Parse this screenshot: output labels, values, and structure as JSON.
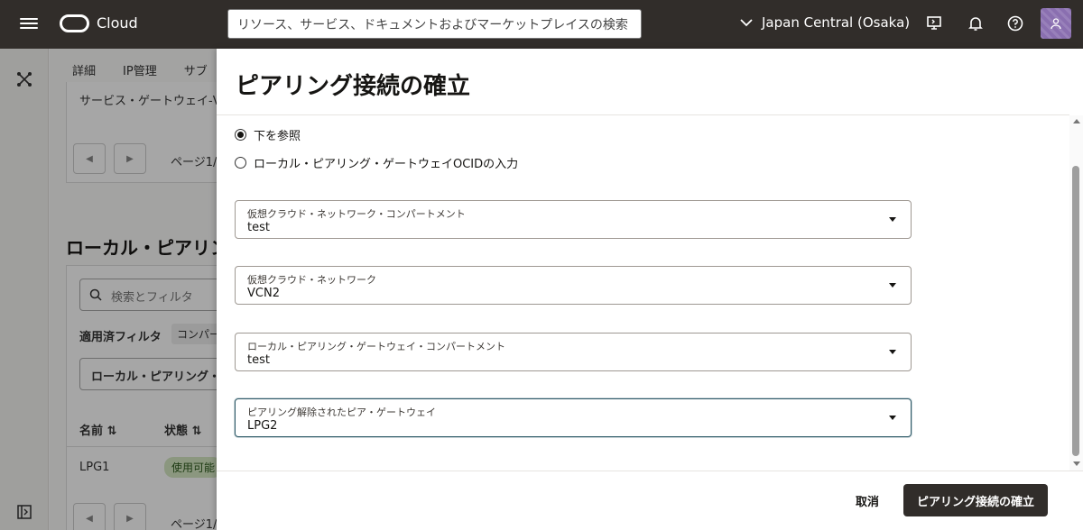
{
  "topbar": {
    "brand": "Cloud",
    "search_placeholder": "リソース、サービス、ドキュメントおよびマーケットプレイスの検索",
    "region": "Japan Central (Osaka)"
  },
  "background": {
    "tabs": [
      "詳細",
      "IP管理",
      "サブ"
    ],
    "service_gateway_text": "サービス・ゲートウェイ-V",
    "page_label_1": "ページ1/",
    "section_title": "ローカル・ピアリン",
    "search_filter_placeholder": "検索とフィルタ",
    "applied_filter_label": "適用済フィルタ",
    "filter_chip": "コンパー",
    "dropdown_text": "ローカル・ピアリング・",
    "col_name": "名前",
    "col_state": "状態",
    "row_name": "LPG1",
    "row_state": "使用可能",
    "page_label_2": "ページ1/"
  },
  "drawer": {
    "title": "ピアリング接続の確立",
    "radio_options": [
      {
        "label": "下を参照",
        "selected": true
      },
      {
        "label": "ローカル・ピアリング・ゲートウェイOCIDの入力",
        "selected": false
      }
    ],
    "fields": [
      {
        "label": "仮想クラウド・ネットワーク・コンパートメント",
        "value": "test"
      },
      {
        "label": "仮想クラウド・ネットワーク",
        "value": "VCN2"
      },
      {
        "label": "ローカル・ピアリング・ゲートウェイ・コンパートメント",
        "value": "test"
      },
      {
        "label": "ピアリング解除されたピア・ゲートウェイ",
        "value": "LPG2"
      }
    ],
    "cancel_label": "取消",
    "submit_label": "ピアリング接続の確立"
  },
  "colors": {
    "topbar_bg": "#312d2a",
    "primary_button_bg": "#312d2a",
    "status_badge_bg": "#d6e8c4",
    "avatar_bg": "#8a6fb0"
  }
}
